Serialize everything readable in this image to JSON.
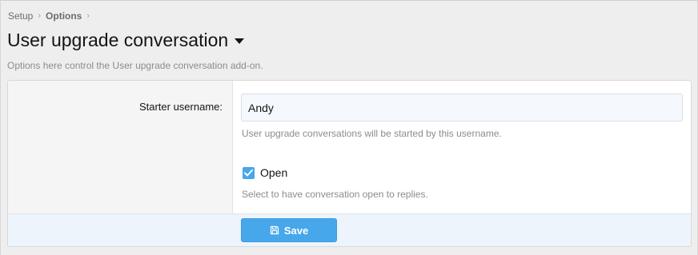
{
  "breadcrumb": {
    "items": [
      "Setup",
      "Options"
    ]
  },
  "page": {
    "title": "User upgrade conversation",
    "description": "Options here control the User upgrade conversation add-on."
  },
  "form": {
    "starter_label": "Starter username:",
    "starter_value": "Andy",
    "starter_hint": "User upgrade conversations will be started by this username.",
    "open_label": "Open",
    "open_checked": true,
    "open_hint": "Select to have conversation open to replies.",
    "save_label": "Save"
  },
  "colors": {
    "accent": "#47a7eb",
    "footer_bg": "#edf4fc"
  },
  "icons": {
    "title_menu": "caret-down-icon",
    "save": "floppy-disk-icon",
    "check": "checkmark-icon"
  }
}
